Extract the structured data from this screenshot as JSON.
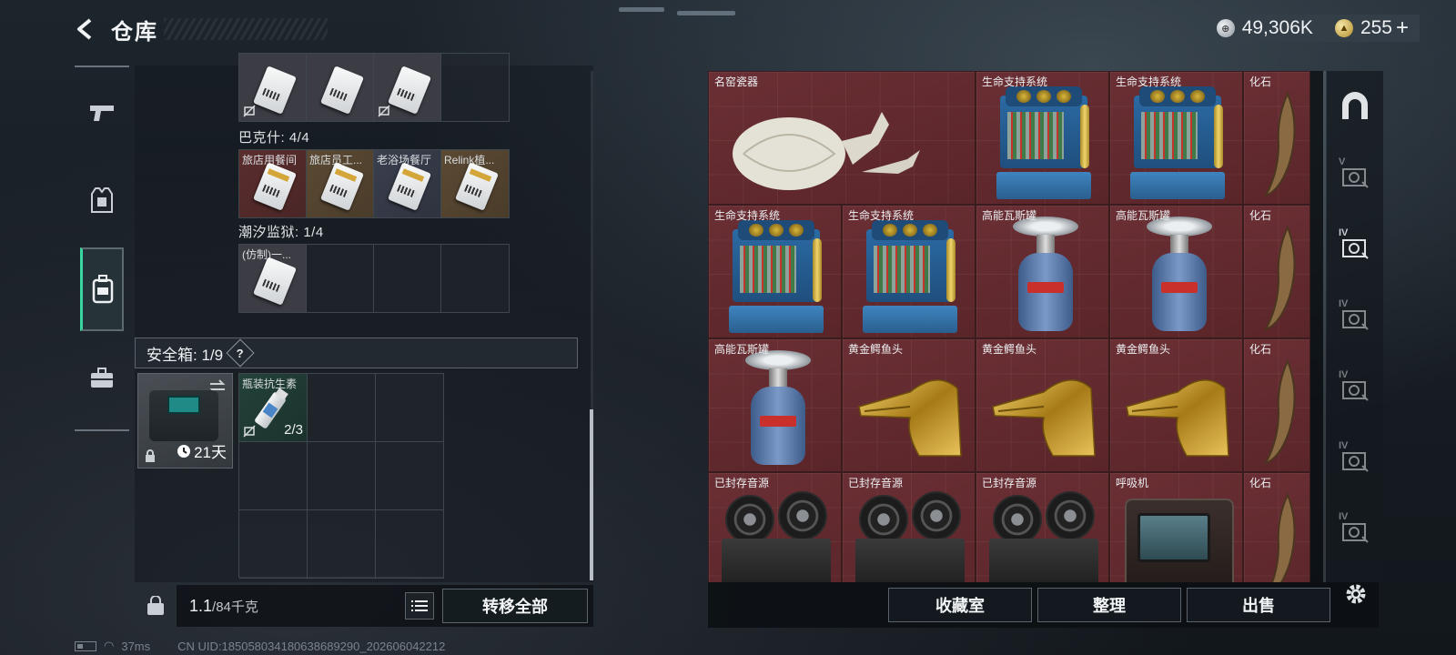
{
  "header": {
    "title": "仓库",
    "back_label": "back"
  },
  "currency": {
    "silver": {
      "value": "49,306K",
      "icon": "silver-coin-icon"
    },
    "gold": {
      "value": "255",
      "plus": "+",
      "icon": "gold-coin-icon"
    }
  },
  "left_nav": [
    {
      "name": "weapons",
      "icon": "pistol-icon"
    },
    {
      "name": "equipment",
      "icon": "vest-icon"
    },
    {
      "name": "backpack",
      "icon": "backpack-icon",
      "active": true
    },
    {
      "name": "briefcase",
      "icon": "briefcase-icon"
    }
  ],
  "keycards": {
    "row1": [
      {
        "label": "",
        "style": "item"
      },
      {
        "label": "",
        "style": "item"
      },
      {
        "label": "",
        "style": "item"
      },
      {
        "label": "",
        "style": "empty"
      }
    ],
    "section2": {
      "label": "巴克什: 4/4"
    },
    "row2": [
      {
        "label": "旅店用餐间",
        "style": "red"
      },
      {
        "label": "旅店员工...",
        "style": "brown"
      },
      {
        "label": "老浴场餐厅",
        "style": "steel"
      },
      {
        "label": "Relink植...",
        "style": "brown"
      }
    ],
    "section3": {
      "label": "潮汐监狱: 1/4"
    },
    "row3": [
      {
        "label": "(仿制)一...",
        "style": "item"
      },
      {
        "label": "",
        "style": "empty"
      },
      {
        "label": "",
        "style": "empty"
      },
      {
        "label": "",
        "style": "empty"
      }
    ]
  },
  "safe": {
    "label": "安全箱: 1/9",
    "help": "?",
    "days": "21天",
    "item": {
      "label": "瓶装抗生素",
      "qty": "2/3"
    }
  },
  "weight": {
    "current": "1.1",
    "max": "/84千克"
  },
  "buttons": {
    "transfer_all": "转移全部",
    "collection": "收藏室",
    "sort": "整理",
    "sell": "出售"
  },
  "stash_items": [
    {
      "label": "名窑瓷器",
      "kind": "vase"
    },
    {
      "label": "生命支持系统",
      "kind": "machine"
    },
    {
      "label": "生命支持系统",
      "kind": "machine"
    },
    {
      "label": "化石",
      "kind": "fossil"
    },
    {
      "label": "生命支持系统",
      "kind": "machine"
    },
    {
      "label": "生命支持系统",
      "kind": "machine"
    },
    {
      "label": "高能瓦斯罐",
      "kind": "tank"
    },
    {
      "label": "高能瓦斯罐",
      "kind": "tank"
    },
    {
      "label": "化石",
      "kind": "fossil"
    },
    {
      "label": "高能瓦斯罐",
      "kind": "tank"
    },
    {
      "label": "黄金鳄鱼头",
      "kind": "croc"
    },
    {
      "label": "黄金鳄鱼头",
      "kind": "croc"
    },
    {
      "label": "黄金鳄鱼头",
      "kind": "croc"
    },
    {
      "label": "化石",
      "kind": "fossil"
    },
    {
      "label": "已封存音源",
      "kind": "reel"
    },
    {
      "label": "已封存音源",
      "kind": "reel"
    },
    {
      "label": "已封存音源",
      "kind": "reel"
    },
    {
      "label": "呼吸机",
      "kind": "resp"
    },
    {
      "label": "化石",
      "kind": "fossil"
    }
  ],
  "right_tabs": [
    {
      "name": "all",
      "icon": "arch-icon",
      "level": ""
    },
    {
      "name": "tier-v",
      "icon": "vault-icon",
      "level": "V"
    },
    {
      "name": "tier-iv-a",
      "icon": "vault-icon",
      "level": "IV"
    },
    {
      "name": "tier-iv-b",
      "icon": "vault-icon",
      "level": "IV"
    },
    {
      "name": "tier-iv-c",
      "icon": "vault-icon",
      "level": "IV"
    },
    {
      "name": "tier-iv-d",
      "icon": "vault-icon",
      "level": "IV"
    },
    {
      "name": "tier-iv-e",
      "icon": "vault-icon",
      "level": "IV"
    }
  ],
  "status": {
    "ping": "37ms",
    "uid": "CN UID:1850580341806386892​90_202606042212"
  }
}
